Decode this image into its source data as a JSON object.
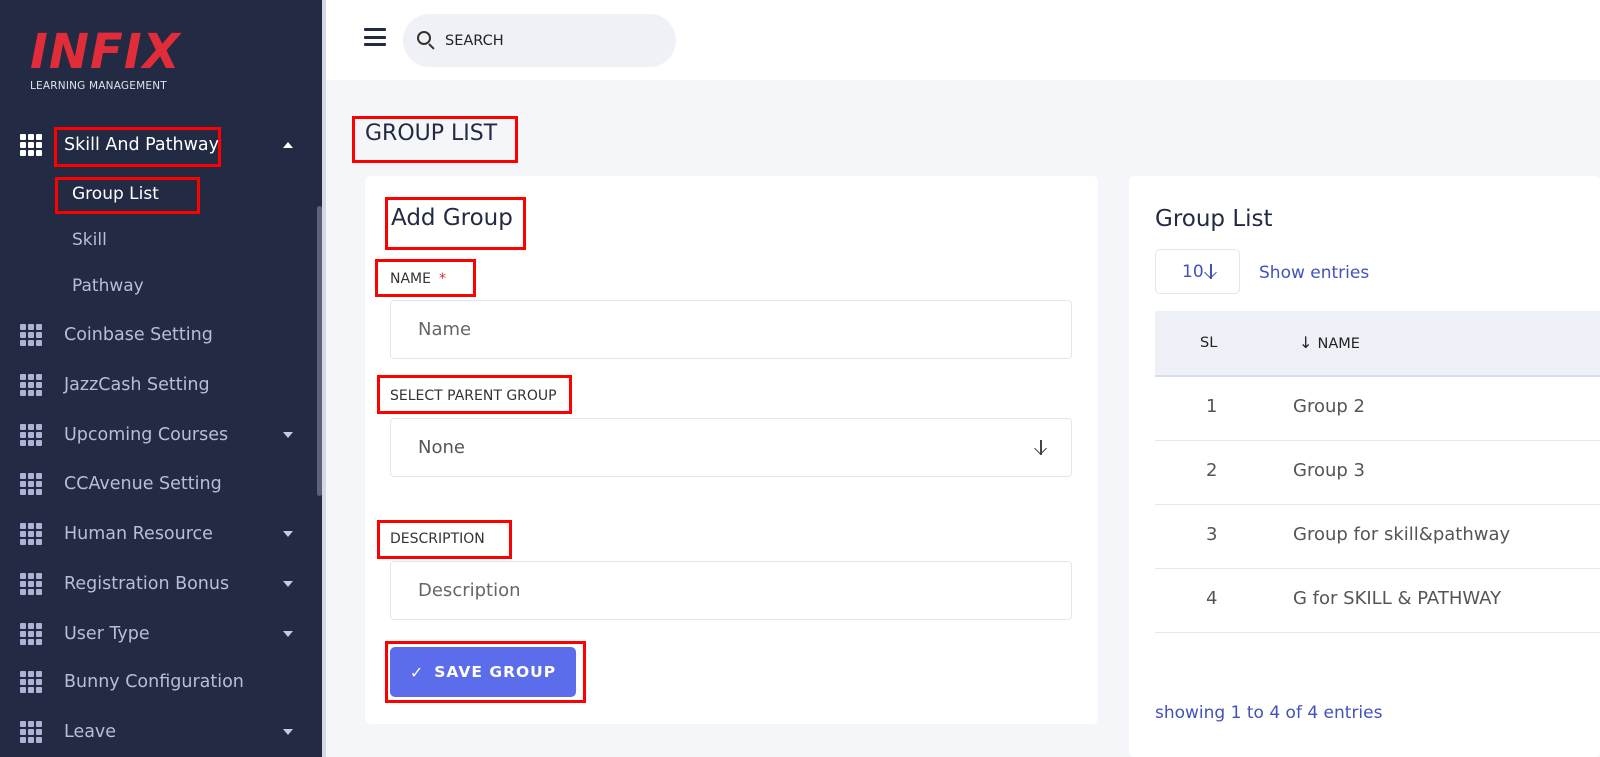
{
  "brand": {
    "logo_text": "INFIX",
    "tagline": "LEARNING MANAGEMENT"
  },
  "sidebar": {
    "active_group": {
      "label": "Skill And Pathway",
      "icon": "grid-icon"
    },
    "sub_items": [
      {
        "label": "Group List",
        "active": true
      },
      {
        "label": "Skill",
        "active": false
      },
      {
        "label": "Pathway",
        "active": false
      }
    ],
    "items": [
      {
        "label": "Coinbase Setting",
        "icon": "grid-icon",
        "has_caret": false
      },
      {
        "label": "JazzCash Setting",
        "icon": "grid-icon",
        "has_caret": false
      },
      {
        "label": "Upcoming Courses",
        "icon": "grid-icon",
        "has_caret": true
      },
      {
        "label": "CCAvenue Setting",
        "icon": "grid-icon",
        "has_caret": false
      },
      {
        "label": "Human Resource",
        "icon": "grid-icon",
        "has_caret": true
      },
      {
        "label": "Registration Bonus",
        "icon": "grid-icon",
        "has_caret": true
      },
      {
        "label": "User Type",
        "icon": "grid-icon",
        "has_caret": true
      },
      {
        "label": "Bunny Configuration",
        "icon": "grid-icon",
        "has_caret": false
      },
      {
        "label": "Leave",
        "icon": "grid-icon",
        "has_caret": true
      }
    ]
  },
  "header": {
    "search_placeholder": "SEARCH"
  },
  "page": {
    "title": "GROUP LIST"
  },
  "form": {
    "title": "Add Group",
    "name_label": "NAME",
    "required_mark": "*",
    "name_placeholder": "Name",
    "parent_label": "SELECT PARENT GROUP",
    "parent_value": "None",
    "description_label": "DESCRIPTION",
    "description_placeholder": "Description",
    "save_label": "SAVE GROUP",
    "save_icon": "✓"
  },
  "list": {
    "title": "Group List",
    "entries_value": "10",
    "show_entries_label": "Show entries",
    "columns": {
      "sl": "SL",
      "name": "NAME"
    },
    "rows": [
      {
        "sl": "1",
        "name": "Group 2"
      },
      {
        "sl": "2",
        "name": "Group 3"
      },
      {
        "sl": "3",
        "name": "Group for skill&pathway"
      },
      {
        "sl": "4",
        "name": "G for SKILL & PATHWAY"
      }
    ],
    "footer": "showing 1 to 4 of 4 entries"
  },
  "colors": {
    "sidebar_bg": "#222b43",
    "accent": "#5b6dea",
    "link": "#4152b8",
    "highlight": "#ff0000",
    "brand_red": "#e12d39"
  }
}
